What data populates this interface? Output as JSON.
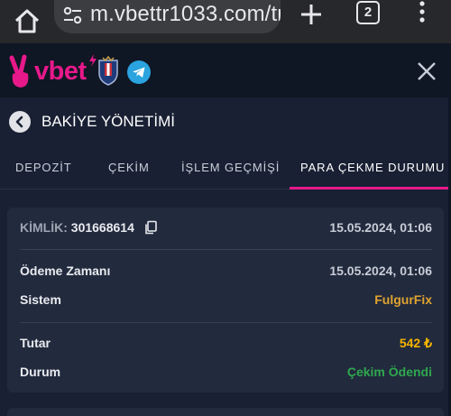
{
  "browser": {
    "url": "m.vbettr1033.com/tr/",
    "tab_count": "2"
  },
  "header": {
    "logo_text": "vbet"
  },
  "page": {
    "title": "BAKİYE YÖNETİMİ"
  },
  "tabs": [
    {
      "label": "DEPOZİT",
      "active": false
    },
    {
      "label": "ÇEKİM",
      "active": false
    },
    {
      "label": "İŞLEM GEÇMİŞİ",
      "active": false
    },
    {
      "label": "PARA ÇEKME DURUMU",
      "active": true
    }
  ],
  "transaction": {
    "id_label": "KİMLİK:",
    "id_value": "301668614",
    "created_at": "15.05.2024, 01:06",
    "payment_time_label": "Ödeme Zamanı",
    "payment_time_value": "15.05.2024, 01:06",
    "system_label": "Sistem",
    "system_value": "FulgurFix",
    "amount_label": "Tutar",
    "amount_value": "542 ₺",
    "status_label": "Durum",
    "status_value": "Çekim Ödendi"
  },
  "colors": {
    "brand": "#e7198a",
    "system": "#e0a330",
    "amount": "#f5b400",
    "status_paid": "#2fa84f"
  }
}
